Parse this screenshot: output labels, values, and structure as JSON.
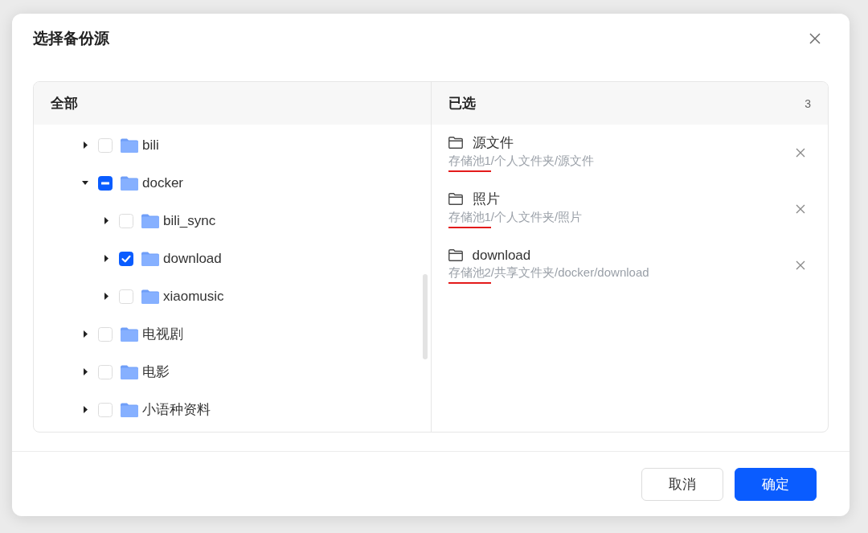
{
  "dialog": {
    "title": "选择备份源"
  },
  "all_panel": {
    "title": "全部",
    "tree": [
      {
        "name": "bili",
        "expanded": false,
        "checked": false,
        "indeterminate": false
      },
      {
        "name": "docker",
        "expanded": true,
        "checked": false,
        "indeterminate": true,
        "children": [
          {
            "name": "bili_sync",
            "expanded": false,
            "checked": false,
            "indeterminate": false
          },
          {
            "name": "download",
            "expanded": false,
            "checked": true,
            "indeterminate": false
          },
          {
            "name": "xiaomusic",
            "expanded": false,
            "checked": false,
            "indeterminate": false
          }
        ]
      },
      {
        "name": "电视剧",
        "expanded": false,
        "checked": false,
        "indeterminate": false
      },
      {
        "name": "电影",
        "expanded": false,
        "checked": false,
        "indeterminate": false
      },
      {
        "name": "小语种资料",
        "expanded": false,
        "checked": false,
        "indeterminate": false
      }
    ]
  },
  "selected_panel": {
    "title": "已选",
    "count": "3",
    "items": [
      {
        "name": "源文件",
        "path": [
          {
            "text": "存储池1",
            "marked": true
          },
          {
            "text": "/个人文件夹/源文件",
            "marked": false
          }
        ]
      },
      {
        "name": "照片",
        "path": [
          {
            "text": "存储池1",
            "marked": true
          },
          {
            "text": "/个人文件夹/照片",
            "marked": false
          }
        ]
      },
      {
        "name": "download",
        "path": [
          {
            "text": "存储池2",
            "marked": true
          },
          {
            "text": "/共享文件夹/docker/download",
            "marked": false
          }
        ]
      }
    ]
  },
  "buttons": [
    {
      "label": "取消",
      "kind": "secondary"
    },
    {
      "label": "确定",
      "kind": "primary"
    }
  ]
}
